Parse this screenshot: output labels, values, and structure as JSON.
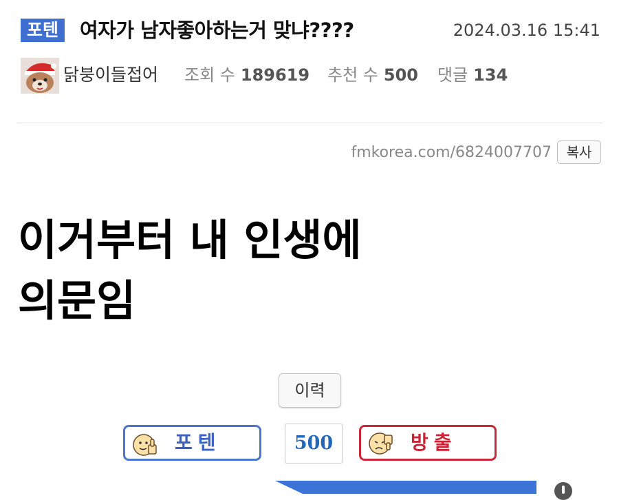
{
  "post": {
    "category": "포텐",
    "title": "여자가 남자좋아하는거 맞냐????",
    "date": "2024.03.16 15:41",
    "author": "닭붕이들접어",
    "views_label": "조회 수",
    "views": "189619",
    "recommend_label": "추천 수",
    "recommend": "500",
    "comments_label": "댓글",
    "comments": "134",
    "short_url": "fmkorea.com/6824007707",
    "copy_label": "복사",
    "content_lines": [
      "이거부터 내 인생에",
      "의문임"
    ]
  },
  "actions": {
    "history_label": "이력",
    "vote_up_label": "포텐",
    "vote_count": "500",
    "vote_down_label": "방출"
  },
  "colors": {
    "badge": "#3f6fd0",
    "vote_up": "#4b76cc",
    "vote_down": "#c9283b",
    "vote_count": "#2467b8",
    "banner": "#3b74d6"
  },
  "icons": {
    "avatar": "santa-dog-avatar",
    "vote_up": "thumbs-up-face-icon",
    "vote_down": "thumbs-down-face-icon"
  }
}
